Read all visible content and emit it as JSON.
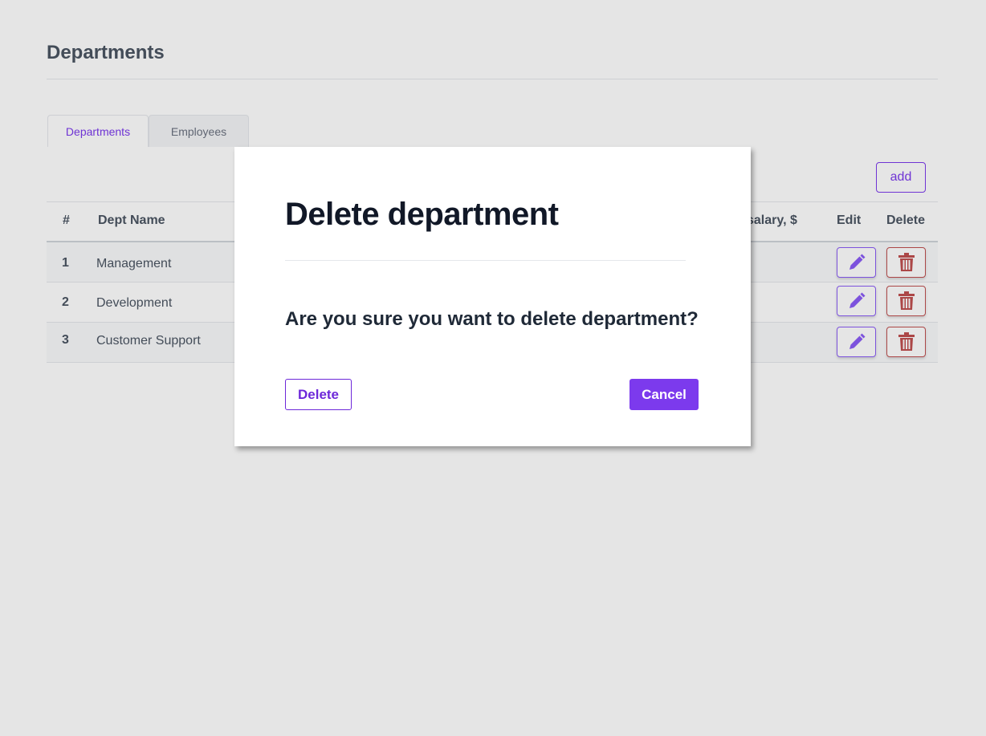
{
  "page": {
    "title": "Departments"
  },
  "tabs": [
    {
      "label": "Departments",
      "active": true
    },
    {
      "label": "Employees",
      "active": false
    }
  ],
  "toolbar": {
    "add_label": "add"
  },
  "table": {
    "columns": {
      "num": "#",
      "name": "Dept Name",
      "salary": "salary, $",
      "edit": "Edit",
      "delete": "Delete"
    },
    "rows": [
      {
        "num": "1",
        "name": "Management"
      },
      {
        "num": "2",
        "name": "Development"
      },
      {
        "num": "3",
        "name": "Customer Support"
      }
    ],
    "edit_icon": "pencil-icon",
    "delete_icon": "trash-icon"
  },
  "modal": {
    "title": "Delete department",
    "question": "Are you sure you want to delete department?",
    "delete_label": "Delete",
    "cancel_label": "Cancel"
  },
  "colors": {
    "accent": "#7c3aed",
    "danger": "#c05050"
  }
}
